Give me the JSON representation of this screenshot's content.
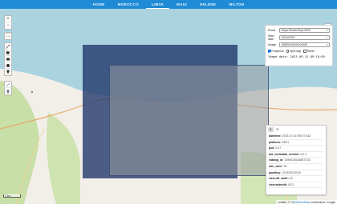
{
  "nav": {
    "items": [
      {
        "label": "HOME"
      },
      {
        "label": "MOROCCO"
      },
      {
        "label": "LIBYA"
      },
      {
        "label": "MAUI"
      },
      {
        "label": "HELENE"
      },
      {
        "label": "MILTON"
      }
    ],
    "active": "LIBYA"
  },
  "map_controls": {
    "zoom_in": "+",
    "zoom_out": "−",
    "fullscreen": "⛶"
  },
  "scale": {
    "label": "2 km"
  },
  "attribution": {
    "prefix": "Leaflet | © ",
    "link": "OpenStreetMap",
    "suffix": " contributors, Google"
  },
  "panel": {
    "event_label": "Event",
    "event_value": "Libya-Floods-Sept-2023",
    "start_label": "Start date",
    "start_value": "01/01/2021",
    "image_label": "Image",
    "image_value": "10500100XXXXXX00",
    "footprints_label": "Footprints",
    "split_map_label": "Split map",
    "reset_label": "Reset",
    "image_date": "Image date: 2023-09-13 09:18:09"
  },
  "metadata": {
    "rows": [
      {
        "key": "datetime:",
        "value": "2023-07-01T09:07:44Z"
      },
      {
        "key": "platform:",
        "value": "GE01"
      },
      {
        "key": "gsd:",
        "value": "0.47"
      },
      {
        "key": "ard_metadata_version:",
        "value": "0.0.1"
      },
      {
        "key": "catalog_id:",
        "value": "105001003A8E7C00"
      },
      {
        "key": "utm_zone:",
        "value": "34"
      },
      {
        "key": "quadkey:",
        "value": "122320210100"
      },
      {
        "key": "view:off_nadir:",
        "value": "22"
      },
      {
        "key": "view:azimuth:",
        "value": "93.2"
      }
    ]
  },
  "colors": {
    "nav_bg": "#1f8bd6",
    "sea": "#aad3df",
    "land": "#f2efe9",
    "overlay_dark": "#22386c",
    "checkbox": "#1a73e8"
  }
}
